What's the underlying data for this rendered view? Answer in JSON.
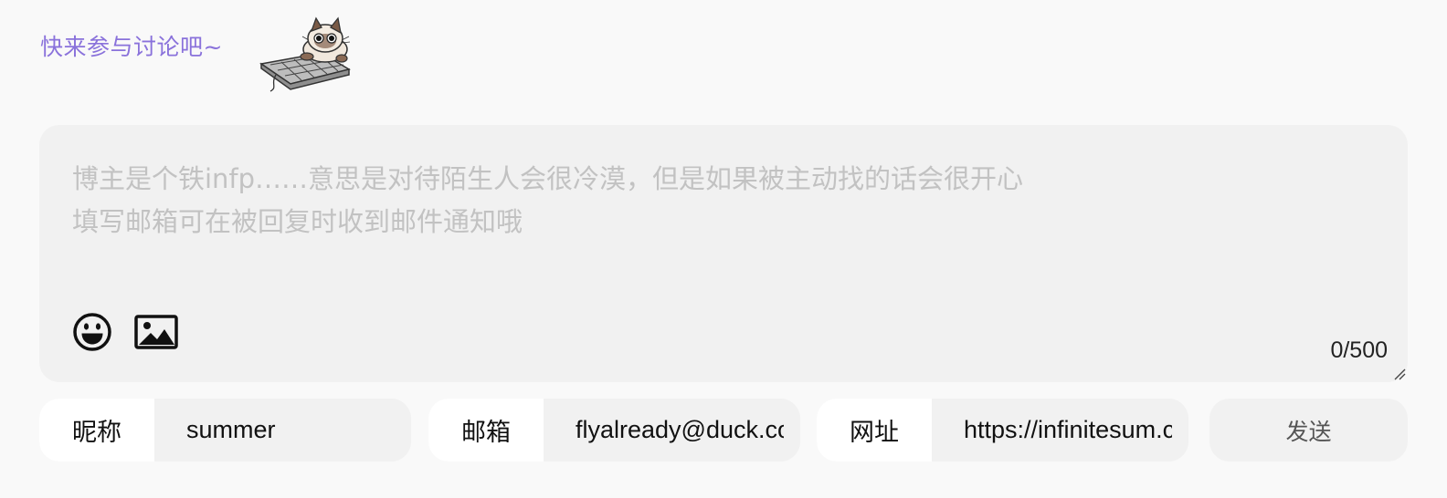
{
  "header": {
    "title": "快来参与讨论吧~",
    "mascot_icon": "cat-keyboard-icon"
  },
  "editor": {
    "placeholder": "博主是个铁infp……意思是对待陌生人会很冷漠，但是如果被主动找的话会很开心\n填写邮箱可在被回复时收到邮件通知哦",
    "counter": "0/500",
    "icons": [
      "emoji-icon",
      "image-icon"
    ]
  },
  "form": {
    "nickname": {
      "label": "昵称",
      "value": "summer"
    },
    "email": {
      "label": "邮箱",
      "value": "flyalready@duck.com"
    },
    "website": {
      "label": "网址",
      "value": "https://infinitesum.com"
    },
    "send_label": "发送"
  },
  "colors": {
    "accent": "#8a72db",
    "panel": "#f1f1f1",
    "background": "#f9f9f9"
  }
}
